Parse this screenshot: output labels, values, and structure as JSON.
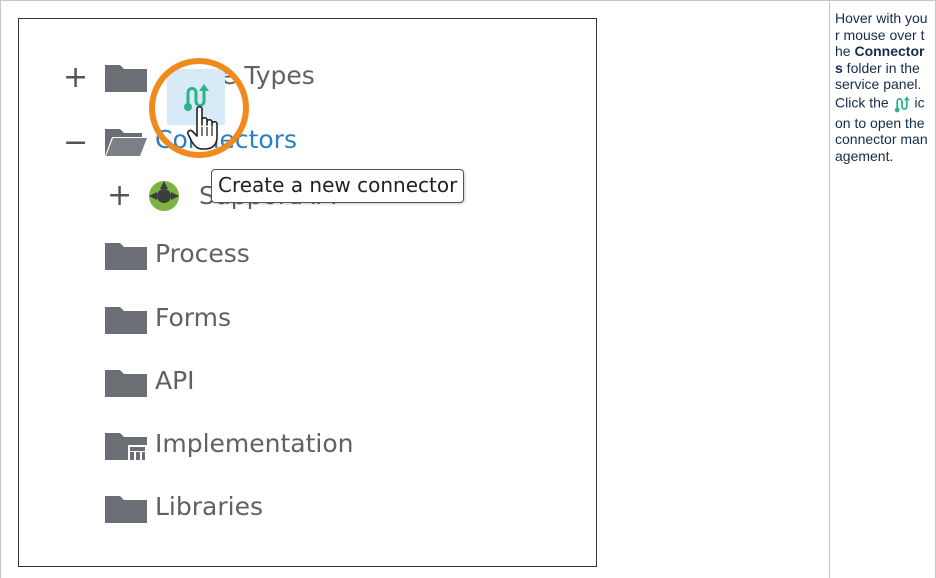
{
  "tree": {
    "items": [
      {
        "toggle": "+",
        "label": "e Types"
      },
      {
        "toggle": "−",
        "label": "Connectors"
      },
      {
        "toggle": "+",
        "label": "SupportAPI"
      },
      {
        "label": "Process"
      },
      {
        "label": "Forms"
      },
      {
        "label": "API"
      },
      {
        "label": "Implementation"
      },
      {
        "label": "Libraries"
      }
    ],
    "tooltip": "Create a new connector"
  },
  "instructions": {
    "p1": "Hover with your mouse over the ",
    "bold1": "Connectors",
    "p2": " folder in the service panel. Click the ",
    "p3": " icon to open the connector management."
  },
  "colors": {
    "folder": "#6b6f75",
    "highlight": "#f08a1c",
    "link": "#2a7fc6",
    "connector_icon": "#2bb48a"
  }
}
